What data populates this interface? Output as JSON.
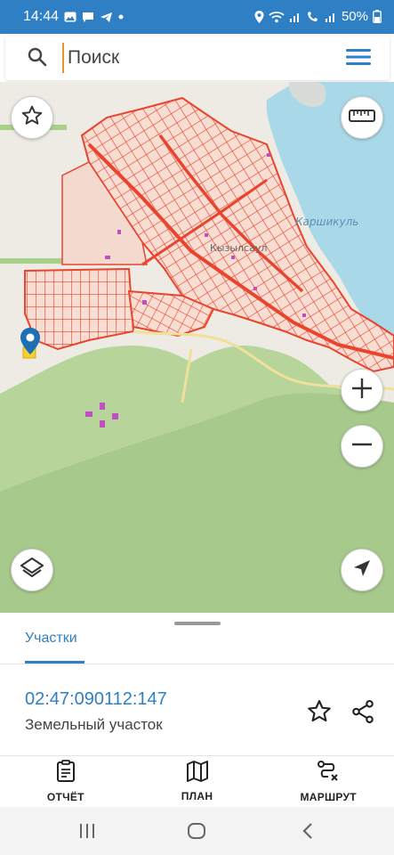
{
  "status_bar": {
    "time": "14:44",
    "battery": "50%",
    "icons": [
      "gallery-icon",
      "chat-icon",
      "telegram-icon",
      "dot-icon",
      "location-icon",
      "wifi-icon",
      "signal-icon",
      "volte-icon",
      "battery-icon"
    ]
  },
  "search": {
    "placeholder": "Поиск",
    "value": ""
  },
  "map": {
    "labels": {
      "lake": "Каршикуль",
      "village": "Кызылсаул"
    },
    "controls": [
      "favorites-icon",
      "ruler-icon",
      "zoom-in-icon",
      "zoom-out-icon",
      "layers-icon",
      "my-location-icon"
    ],
    "colors": {
      "water": "#a9d8e8",
      "forest": "#b7d59a",
      "parcel_stroke": "#e8442e",
      "parcel_fill": "#f6d2c8",
      "marker": "#1f6fb5"
    }
  },
  "panel": {
    "tab_label": "Участки",
    "parcel_id": "02:47:090112:147",
    "parcel_type": "Земельный участок"
  },
  "actions": {
    "report": "ОТЧЁТ",
    "plan": "ПЛАН",
    "route": "МАРШРУТ"
  },
  "colors": {
    "accent": "#2f7fc4"
  }
}
